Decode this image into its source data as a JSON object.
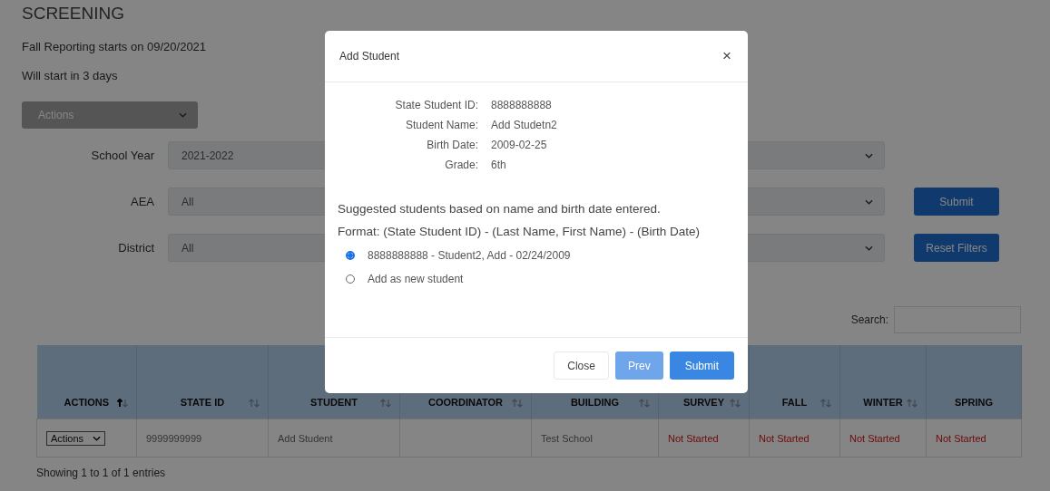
{
  "page": {
    "title": "SCREENING",
    "notices": [
      "Fall Reporting starts on 09/20/2021",
      "Will start in 3 days"
    ],
    "actions_select": "Actions",
    "filters": [
      {
        "label": "School Year",
        "value": "2021-2022"
      },
      {
        "label": "AEA",
        "value": "All",
        "button": "Submit"
      },
      {
        "label": "District",
        "value": "All",
        "button": "Reset Filters"
      }
    ],
    "search": {
      "label": "Search:"
    },
    "table": {
      "columns": [
        {
          "label": "ACTIONS",
          "sortable": true,
          "sorted": true
        },
        {
          "label": "STATE ID",
          "sortable": true,
          "sorted": false
        },
        {
          "label": "STUDENT",
          "sortable": true,
          "sorted": false
        },
        {
          "label": "COORDINATOR",
          "sortable": true,
          "sorted": false
        },
        {
          "label": "BUILDING",
          "sortable": true,
          "sorted": false
        },
        {
          "label": "SURVEY",
          "sortable": true,
          "sorted": false
        },
        {
          "label": "FALL",
          "sortable": true,
          "sorted": false
        },
        {
          "label": "WINTER",
          "sortable": true,
          "sorted": false
        },
        {
          "label": "SPRING",
          "sortable": false
        }
      ],
      "rows": [
        {
          "cells": [
            {
              "kind": "select",
              "text": "Actions"
            },
            {
              "kind": "text",
              "text": "9999999999"
            },
            {
              "kind": "text",
              "text": "Add Student"
            },
            {
              "kind": "empty"
            },
            {
              "kind": "text",
              "text": "Test School"
            },
            {
              "kind": "status",
              "text": "Not Started"
            },
            {
              "kind": "status",
              "text": "Not Started"
            },
            {
              "kind": "status",
              "text": "Not Started"
            },
            {
              "kind": "status",
              "text": "Not Started"
            }
          ]
        }
      ]
    },
    "footer": "Showing 1 to 1 of 1 entries"
  },
  "dialog": {
    "title": "Add Student",
    "close": "×",
    "fields": [
      {
        "label": "State Student ID:",
        "value": "8888888888"
      },
      {
        "label": "Student Name:",
        "value": "Add Studetn2"
      },
      {
        "label": "Birth Date:",
        "value": "2009-02-25"
      },
      {
        "label": "Grade:",
        "value": "6th"
      }
    ],
    "intro": "Suggested students based on name and birth date entered.",
    "format": "Format: (State Student ID) - (Last Name, First Name) - (Birth Date)",
    "options": [
      {
        "label": "8888888888 - Student2, Add - 02/24/2009",
        "selected": true
      },
      {
        "label": "Add as new student",
        "selected": false
      }
    ],
    "buttons": [
      {
        "label": "Close",
        "kind": "default"
      },
      {
        "label": "Prev",
        "kind": "light"
      },
      {
        "label": "Submit",
        "kind": "primary"
      }
    ]
  }
}
